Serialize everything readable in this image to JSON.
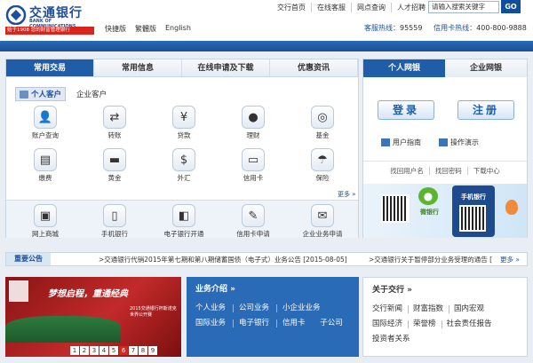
{
  "header": {
    "logo_cn": "交通银行",
    "logo_en": "BANK OF COMMUNICATIONS",
    "logo_tag": "始于1908 您的财富管理银行",
    "lang": [
      "快捷版",
      "繁體版",
      "English"
    ],
    "top_links": [
      "交行首页",
      "在线客服",
      "网点查询",
      "人才招聘"
    ],
    "search_placeholder": "请输入搜索关键字",
    "search_button": "GO",
    "hotline_label": "客服热线：",
    "hotline": "95559",
    "card_hotline_label": "信用卡热线：",
    "card_hotline": "400-800-9888"
  },
  "main": {
    "tabs": [
      "常用交易",
      "常用信息",
      "在线申请及下载",
      "优惠资讯"
    ],
    "customer_tabs": [
      "个人客户",
      "企业客户"
    ],
    "items": [
      "账户查询",
      "转账",
      "贷款",
      "理财",
      "基金",
      "缴费",
      "黄金",
      "外汇",
      "信用卡",
      "保险"
    ],
    "more": "更多 »",
    "sub_items": [
      "网上商城",
      "手机银行",
      "电子银行开通",
      "信用卡申请",
      "企业业务申请"
    ]
  },
  "right": {
    "tabs": [
      "个人网银",
      "企业网银"
    ],
    "login": "登录",
    "register": "注册",
    "guide": "用户指南",
    "demo": "操作演示",
    "links": [
      "找回用户名",
      "找回密码",
      "下载中心"
    ],
    "wechat": "微银行",
    "mobile": "手机银行"
  },
  "notice": {
    "title": "重要公告",
    "text1": ">交通银行代销2015年第七期和第八期储蓄国债（电子式）业务公告 [2015-08-05]",
    "text2": ">交通银行关于暂停部分业务受理的通告 [",
    "more": "更多 »"
  },
  "banner": {
    "title": "梦想启程，重通经典",
    "sub": "2015交通银行杯斯诺克世界公开赛",
    "pages": [
      "1",
      "2",
      "3",
      "4",
      "5",
      "6",
      "7",
      "8",
      "9"
    ],
    "active_page": "6"
  },
  "biz": {
    "title": "业务介绍 »",
    "links": [
      "个人业务",
      "公司业务",
      "小企业业务",
      "国际业务",
      "电子银行",
      "信用卡",
      "子公司"
    ]
  },
  "about": {
    "title": "关于交行 »",
    "links": [
      "交行新闻",
      "财富指数",
      "国内宏观",
      "国际经济",
      "荣誉榜",
      "社会责任报告",
      "投资者关系"
    ]
  }
}
